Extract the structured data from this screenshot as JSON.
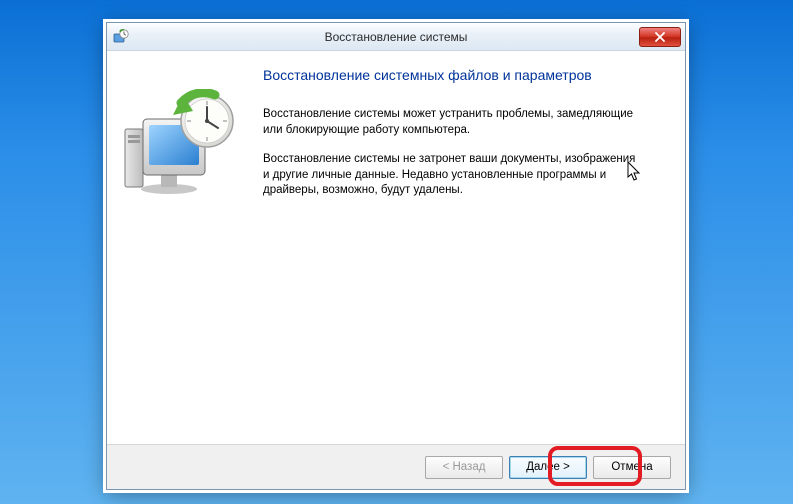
{
  "titlebar": {
    "title": "Восстановление системы"
  },
  "main": {
    "heading": "Восстановление системных файлов и параметров",
    "para1": "Восстановление системы может устранить проблемы, замедляющие или блокирующие работу компьютера.",
    "para2": "Восстановление системы не затронет ваши документы, изображения и другие личные данные. Недавно установленные программы и драйверы, возможно, будут удалены."
  },
  "footer": {
    "back": "< Назад",
    "next": "Далее >",
    "cancel": "Отмена"
  }
}
